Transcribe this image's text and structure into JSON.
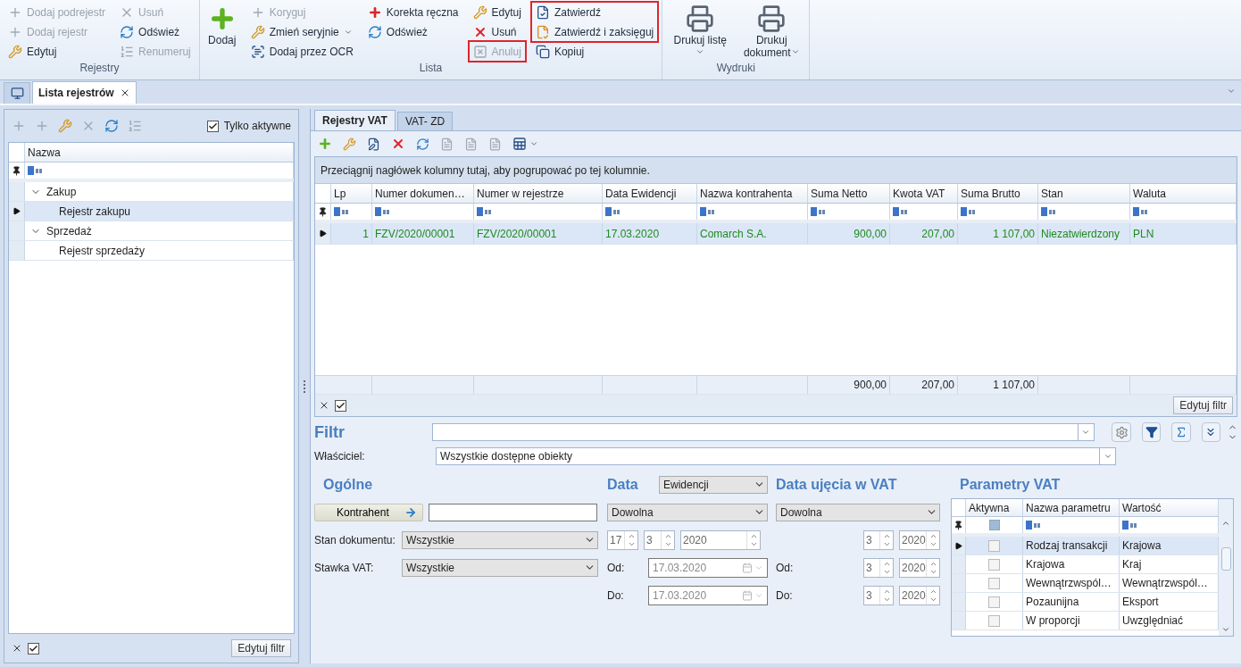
{
  "ribbon": {
    "groups": [
      {
        "label": "Rejestry",
        "columns": [
          {
            "kind": "small",
            "items": [
              {
                "label": "Dodaj podrejestr",
                "disabled": true,
                "dropdown": false,
                "highlighted": false
              },
              {
                "label": "Dodaj rejestr",
                "disabled": true,
                "dropdown": false,
                "highlighted": false
              },
              {
                "label": "Edytuj",
                "disabled": false,
                "dropdown": false,
                "highlighted": false
              }
            ]
          },
          {
            "kind": "small",
            "items": [
              {
                "label": "Usuń",
                "disabled": true,
                "dropdown": false,
                "highlighted": false
              },
              {
                "label": "Odśwież",
                "disabled": false,
                "dropdown": false,
                "highlighted": false
              },
              {
                "label": "Renumeruj",
                "disabled": true,
                "dropdown": false,
                "highlighted": false
              }
            ]
          }
        ]
      },
      {
        "label": "Lista",
        "columns": [
          {
            "kind": "large",
            "items": [
              {
                "label": "Dodaj",
                "disabled": false,
                "dropdown": false
              }
            ]
          },
          {
            "kind": "small",
            "items": [
              {
                "label": "Koryguj",
                "disabled": true,
                "dropdown": false,
                "highlighted": false
              },
              {
                "label": "Zmień seryjnie",
                "disabled": false,
                "dropdown": true,
                "highlighted": false
              },
              {
                "label": "Dodaj przez OCR",
                "disabled": false,
                "dropdown": false,
                "highlighted": false
              }
            ]
          },
          {
            "kind": "small",
            "items": [
              {
                "label": "Korekta ręczna",
                "disabled": false,
                "dropdown": false,
                "highlighted": false
              },
              {
                "label": "Odśwież",
                "disabled": false,
                "dropdown": false,
                "highlighted": false
              }
            ]
          },
          {
            "kind": "small",
            "items": [
              {
                "label": "Edytuj",
                "disabled": false,
                "dropdown": false,
                "highlighted": false
              },
              {
                "label": "Usuń",
                "disabled": false,
                "dropdown": false,
                "highlighted": false
              },
              {
                "label": "Anuluj",
                "disabled": true,
                "dropdown": false,
                "highlighted": true
              }
            ]
          },
          {
            "kind": "small",
            "items": [
              {
                "label": "Zatwierdź",
                "disabled": false,
                "dropdown": false,
                "highlighted": true
              },
              {
                "label": "Zatwierdź i zaksięguj",
                "disabled": false,
                "dropdown": false,
                "highlighted": true
              },
              {
                "label": "Kopiuj",
                "disabled": false,
                "dropdown": false,
                "highlighted": false
              }
            ]
          }
        ]
      },
      {
        "label": "Wydruki",
        "columns": [
          {
            "kind": "large",
            "items": [
              {
                "label": "Drukuj listę",
                "disabled": false,
                "dropdown": true
              },
              {
                "label": "Drukuj dokument",
                "disabled": false,
                "dropdown": true
              }
            ]
          }
        ]
      }
    ]
  },
  "document_tabs": [
    {
      "label": "Lista rejestrów",
      "selected": true
    }
  ],
  "left_panel": {
    "only_active": {
      "label": "Tylko aktywne",
      "checked": true
    },
    "tree": {
      "column": "Nazwa",
      "items": [
        {
          "label": "Zakup",
          "expanded": true,
          "selected": false,
          "children": [
            {
              "label": "Rejestr zakupu",
              "selected": true
            }
          ]
        },
        {
          "label": "Sprzedaż",
          "expanded": true,
          "selected": false,
          "children": [
            {
              "label": "Rejestr sprzedaży",
              "selected": false
            }
          ]
        }
      ]
    },
    "filter_on": {
      "checked": true
    },
    "edit_filter": "Edytuj filtr"
  },
  "right_panel": {
    "tabs": [
      {
        "label": "Rejestry VAT",
        "selected": true
      },
      {
        "label": "VAT- ZD",
        "selected": false
      }
    ],
    "grid": {
      "group_hint": "Przeciągnij nagłówek kolumny tutaj, aby pogrupować po tej kolumnie.",
      "columns": [
        {
          "label": "Lp",
          "kind": "number"
        },
        {
          "label": "Numer dokumen…",
          "kind": "text"
        },
        {
          "label": "Numer w rejestrze",
          "kind": "text"
        },
        {
          "label": "Data Ewidencji",
          "kind": "text"
        },
        {
          "label": "Nazwa kontrahenta",
          "kind": "text"
        },
        {
          "label": "Suma Netto",
          "kind": "number",
          "total": "900,00"
        },
        {
          "label": "Kwota VAT",
          "kind": "number",
          "total": "207,00"
        },
        {
          "label": "Suma Brutto",
          "kind": "number",
          "total": "1 107,00"
        },
        {
          "label": "Stan",
          "kind": "text"
        },
        {
          "label": "Waluta",
          "kind": "text"
        }
      ],
      "rows": [
        {
          "selected": true,
          "cells": [
            "1",
            "FZV/2020/00001",
            "FZV/2020/00001",
            "17.03.2020",
            "Comarch S.A.",
            "900,00",
            "207,00",
            "1 107,00",
            "Niezatwierdzony",
            "PLN"
          ]
        }
      ],
      "filter_on": {
        "checked": true
      },
      "edit_filter": "Edytuj filtr"
    },
    "filter": {
      "title": "Filtr",
      "owner_label": "Właściciel:",
      "owner_value": "Wszystkie dostępne obiekty",
      "general": {
        "title": "Ogólne",
        "contractor_button": "Kontrahent",
        "document_state_label": "Stan dokumentu:",
        "document_state": "Wszystkie",
        "vat_rate_label": "Stawka VAT:",
        "vat_rate": "Wszystkie"
      },
      "date": {
        "title": "Data",
        "type": "Ewidencji",
        "range": "Dowolna",
        "day": "17",
        "month": "3",
        "year": "2020",
        "from_label": "Od:",
        "from": {
          "value": "17.03.2020",
          "disabled": true
        },
        "to_label": "Do:",
        "to": {
          "value": "17.03.2020",
          "disabled": true
        }
      },
      "vat_date": {
        "title": "Data ujęcia w VAT",
        "range": "Dowolna",
        "month": "3",
        "year": "2020",
        "from_label": "Od:",
        "from_month": "3",
        "from_year": "2020",
        "to_label": "Do:",
        "to_month": "3",
        "to_year": "2020"
      },
      "vat_params": {
        "title": "Parametry VAT",
        "columns": [
          "Aktywna",
          "Nazwa parametru",
          "Wartość"
        ],
        "filter_checkbox": {
          "indeterminate": true
        },
        "rows": [
          {
            "checked": false,
            "selected": true,
            "name": "Rodzaj transakcji",
            "value": "Krajowa"
          },
          {
            "checked": false,
            "selected": false,
            "name": "Krajowa",
            "value": "Kraj"
          },
          {
            "checked": false,
            "selected": false,
            "name": "Wewnątrzwspól…",
            "value": "Wewnątrzwspól…"
          },
          {
            "checked": false,
            "selected": false,
            "name": "Pozaunijna",
            "value": "Eksport"
          },
          {
            "checked": false,
            "selected": false,
            "name": "W proporcji",
            "value": "Uwzględniać"
          }
        ]
      }
    }
  }
}
